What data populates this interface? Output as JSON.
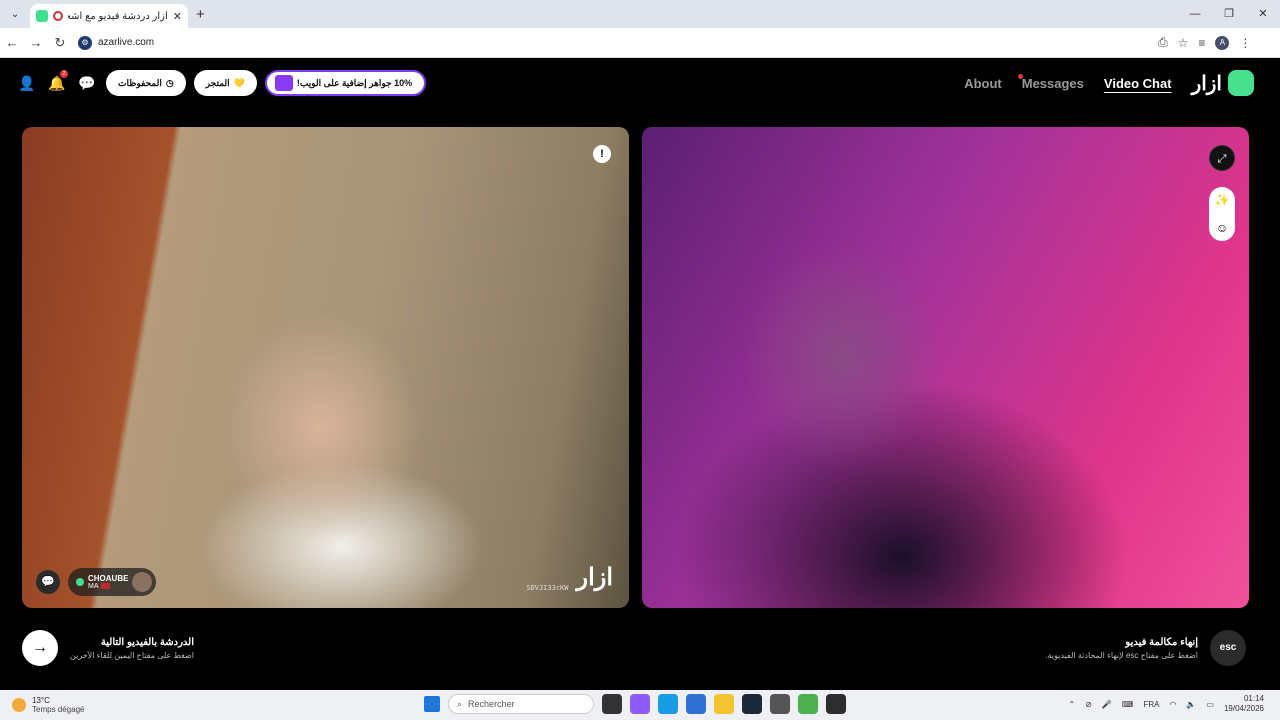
{
  "browser": {
    "tab_title": "أزار دردشة فيديو مع أشخاص",
    "tab_close": "✕",
    "new_tab": "+",
    "url": "azarlive.com",
    "profile_initial": "A",
    "window_controls": [
      "—",
      "❐",
      "✕"
    ]
  },
  "header": {
    "promo_label": "10% جواهر إضافية على الويب!",
    "shop_label": "المتجر",
    "saved_label": "المحفوظات",
    "notif_count": "2",
    "nav": [
      {
        "label": "About"
      },
      {
        "label": "Messages"
      },
      {
        "label": "Video Chat"
      }
    ],
    "logo_text": "ازار"
  },
  "left_video": {
    "user_name": "CHOAUBE",
    "user_country": "MA",
    "watermark_code": "SDVJI33cKW",
    "watermark_logo": "ازار"
  },
  "bottom": {
    "next_title": "الدردشة بالفيديو التالية",
    "next_sub": "اضغط على مفتاح اليمين للقاء الآخرين",
    "end_title": "إنهاء مكالمة فيديو",
    "end_sub": "اضغط على مفتاح esc لإنهاء المحادثة الفيديوية.",
    "esc_label": "esc"
  },
  "taskbar": {
    "temperature": "13°C",
    "weather_desc": "Temps dégagé",
    "search_placeholder": "Rechercher",
    "language": "FRA",
    "time": "01:14",
    "date": "19/04/2026"
  },
  "colors": {
    "brand_green": "#46e08e",
    "promo_purple": "#7b3cf2",
    "notif_red": "#ee3333"
  }
}
